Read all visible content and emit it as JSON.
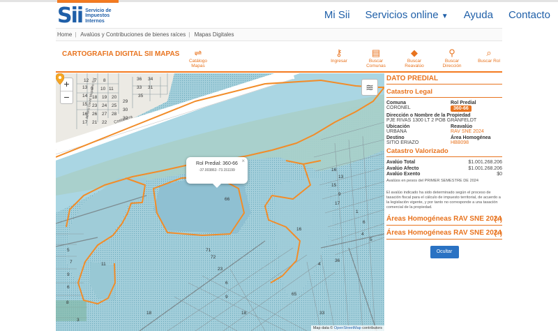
{
  "header": {
    "logo_mark": "Sii",
    "logo_line1": "Servicio de",
    "logo_line2": "Impuestos",
    "logo_line3": "Internos",
    "nav": {
      "mi_sii": "Mi Sii",
      "servicios": "Servicios online",
      "ayuda": "Ayuda",
      "contacto": "Contacto"
    }
  },
  "breadcrumb": {
    "home": "Home",
    "section": "Avalúos y Contribuciones de bienes raíces",
    "page": "Mapas Digitales"
  },
  "toolbar": {
    "title": "CARTOGRAFIA DIGITAL SII MAPAS",
    "catalogo": "Catálogo Mapas",
    "ingresar": "Ingresar",
    "buscar_comunas": "Buscar Comunas",
    "buscar_reavaluo": "Buscar Reavalúo",
    "buscar_direccion": "Buscar Dirección",
    "buscar_rol": "Buscar Rol"
  },
  "map": {
    "zoom_in": "+",
    "zoom_out": "−",
    "street": "Costanera",
    "street2": "Mirtero David Mapuelo Sur",
    "popup_title": "Rol Predial: 360-66",
    "popup_coords": "-37.003863   -73.151199",
    "popup_close": "×",
    "attrib_prefix": "Map data ©",
    "attrib_link": "OpenStreetMap",
    "attrib_suffix": "contributors",
    "lot_labels": [
      "12",
      "7",
      "8",
      "9",
      "10",
      "11",
      "13",
      "14",
      "15",
      "16",
      "17",
      "18",
      "19",
      "20",
      "21",
      "22",
      "23",
      "24",
      "25",
      "26",
      "27",
      "28",
      "29",
      "30",
      "33",
      "36",
      "34",
      "32",
      "31",
      "35"
    ],
    "parcel_labels": [
      "71",
      "72",
      "23",
      "11",
      "65",
      "16",
      "18",
      "33",
      "4",
      "36",
      "66",
      "8",
      "6",
      "9",
      "7",
      "5",
      "16",
      "13",
      "15",
      "9",
      "17",
      "1",
      "6",
      "4",
      "5"
    ]
  },
  "panel": {
    "dato_predial": "DATO PREDIAL",
    "catastro_legal": "Catastro Legal",
    "comuna_lbl": "Comuna",
    "comuna_val": "CORONEL",
    "rol_lbl": "Rol Predial",
    "rol_val": "360-66",
    "direccion_lbl": "Dirección o Nombre de la Propiedad",
    "direccion_val": "PJE RIVAS 1300 LT 2 POB GRANFELDT",
    "ubicacion_lbl": "Ubicación",
    "ubicacion_val": "URBANA",
    "reavaluo_lbl": "Reavalúo",
    "reavaluo_val": "RAV SNE 2024",
    "destino_lbl": "Destino",
    "destino_val": "SITIO ERIAZO",
    "area_lbl": "Área Homogénea",
    "area_val": "HBB098",
    "catastro_valorizado": "Catastro Valorizado",
    "avaluo_total_lbl": "Avalúo Total",
    "avaluo_total_val": "$1.001.268.206",
    "avaluo_afecto_lbl": "Avalúo Afecto",
    "avaluo_afecto_val": "$1.001.268.206",
    "avaluo_exento_lbl": "Avalúo Exento",
    "avaluo_exento_val": "$0",
    "semestre_note": "Avalúos en pesos del PRIMER SEMESTRE DE 2024",
    "disclaimer": "El avalúo indicado ha sido determinado según el proceso de tasación fiscal para el cálculo de impuesto territorial, de acuerdo a la legislación vigente, y por tanto no corresponde a una tasación comercial de la propiedad.",
    "areas1": "Áreas Homogéneas RAV SNE 2024",
    "areas2": "Áreas Homogéneas RAV SNE 2024",
    "plus": "(+)",
    "ocultar": "Ocultar"
  },
  "colors": {
    "accent": "#e8731e",
    "brand": "#1f5fa8",
    "water": "#a9d3de",
    "button": "#2a72c3"
  }
}
